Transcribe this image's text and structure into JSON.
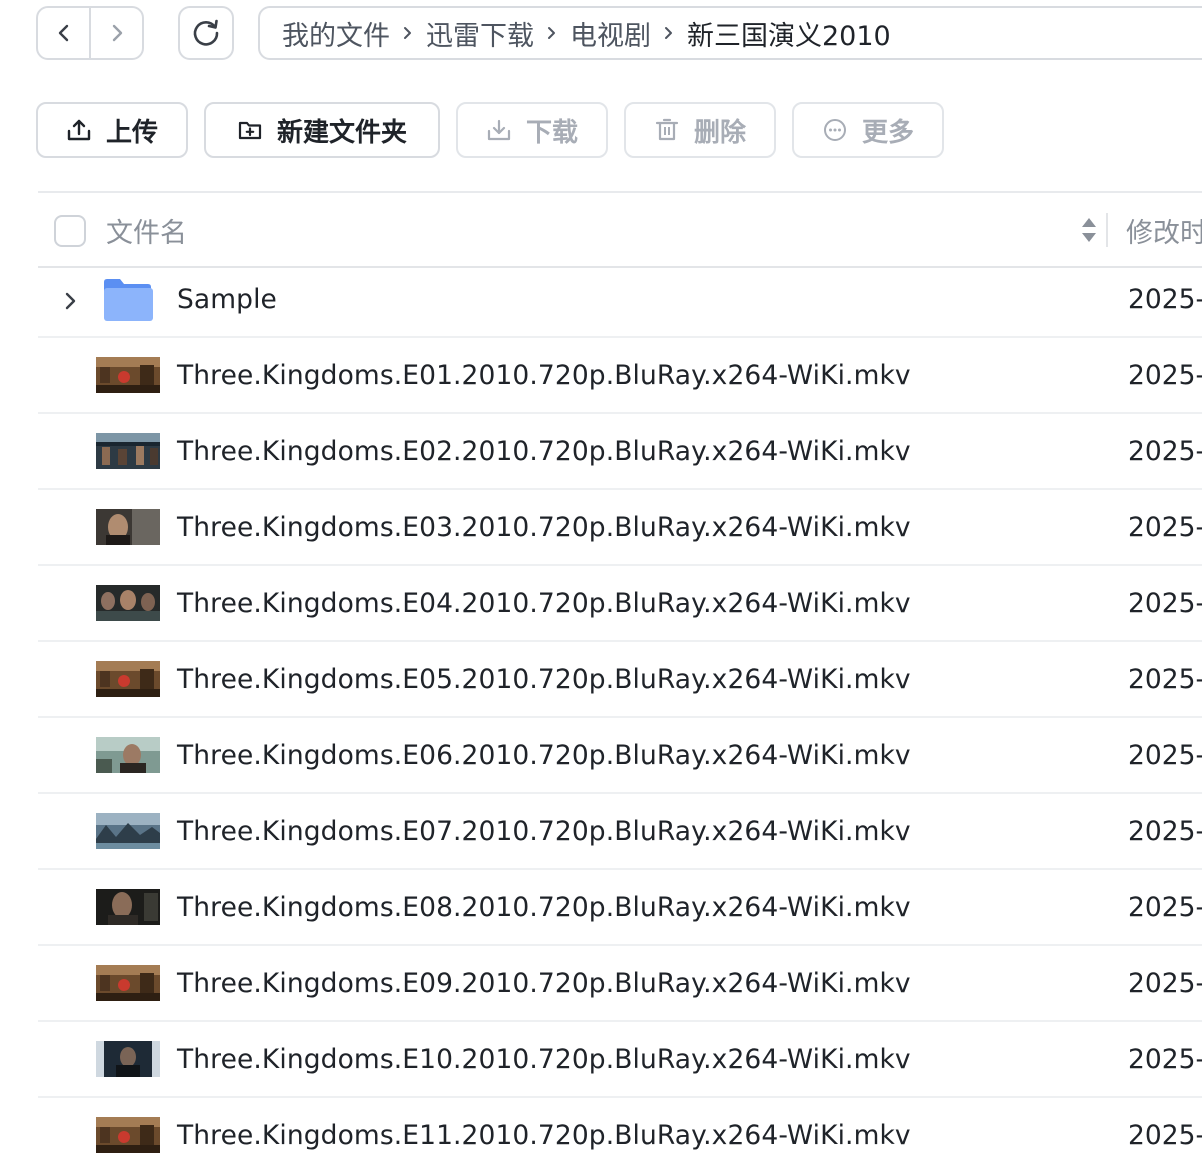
{
  "breadcrumb": {
    "items": [
      "我的文件",
      "迅雷下载",
      "电视剧",
      "新三国演义2010"
    ]
  },
  "toolbar": {
    "upload": "上传",
    "new_folder": "新建文件夹",
    "download": "下载",
    "delete": "删除",
    "more": "更多"
  },
  "table": {
    "col_name": "文件名",
    "col_modified": "修改时"
  },
  "folder": {
    "name": "Sample",
    "modified": "2025-"
  },
  "files": [
    {
      "name": "Three.Kingdoms.E01.2010.720p.BluRay.x264-WiKi.mkv",
      "modified": "2025-"
    },
    {
      "name": "Three.Kingdoms.E02.2010.720p.BluRay.x264-WiKi.mkv",
      "modified": "2025-"
    },
    {
      "name": "Three.Kingdoms.E03.2010.720p.BluRay.x264-WiKi.mkv",
      "modified": "2025-"
    },
    {
      "name": "Three.Kingdoms.E04.2010.720p.BluRay.x264-WiKi.mkv",
      "modified": "2025-"
    },
    {
      "name": "Three.Kingdoms.E05.2010.720p.BluRay.x264-WiKi.mkv",
      "modified": "2025-"
    },
    {
      "name": "Three.Kingdoms.E06.2010.720p.BluRay.x264-WiKi.mkv",
      "modified": "2025-"
    },
    {
      "name": "Three.Kingdoms.E07.2010.720p.BluRay.x264-WiKi.mkv",
      "modified": "2025-"
    },
    {
      "name": "Three.Kingdoms.E08.2010.720p.BluRay.x264-WiKi.mkv",
      "modified": "2025-"
    },
    {
      "name": "Three.Kingdoms.E09.2010.720p.BluRay.x264-WiKi.mkv",
      "modified": "2025-"
    },
    {
      "name": "Three.Kingdoms.E10.2010.720p.BluRay.x264-WiKi.mkv",
      "modified": "2025-"
    },
    {
      "name": "Three.Kingdoms.E11.2010.720p.BluRay.x264-WiKi.mkv",
      "modified": "2025-"
    }
  ],
  "colors": {
    "border": "#d8dbe0",
    "text": "#1f2329",
    "muted": "#8a9099",
    "disabled": "#a8adb6",
    "folder": "#7aa8f7"
  }
}
